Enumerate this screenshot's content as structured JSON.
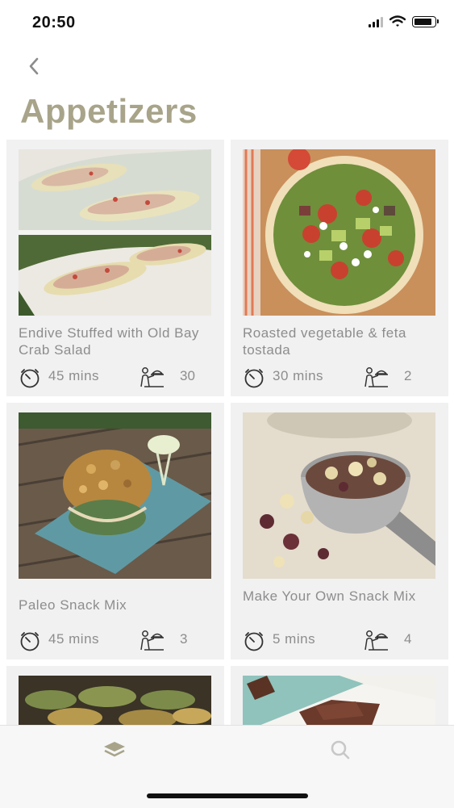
{
  "status_bar": {
    "time": "20:50"
  },
  "header": {
    "title": "Appetizers"
  },
  "icons": {
    "back": "chevron-left-icon",
    "timer": "stopwatch-icon",
    "serves": "waiter-serving-icon",
    "tab_recipes": "layers-icon",
    "tab_search": "search-icon"
  },
  "colors": {
    "title": "#a8a48a",
    "card_bg": "#f1f1f2",
    "text": "#8d8d8d",
    "tab_active": "#a8a48a",
    "tab_inactive": "#c8c8c8"
  },
  "recipes": [
    {
      "name": "Endive Stuffed with Old Bay Crab Salad",
      "time": "45 mins",
      "serves": "30"
    },
    {
      "name": "Roasted vegetable & feta tostada",
      "time": "30 mins",
      "serves": "2"
    },
    {
      "name": "Paleo Snack Mix",
      "time": "45 mins",
      "serves": "3"
    },
    {
      "name": "Make Your Own Snack Mix",
      "time": "5 mins",
      "serves": "4"
    }
  ]
}
